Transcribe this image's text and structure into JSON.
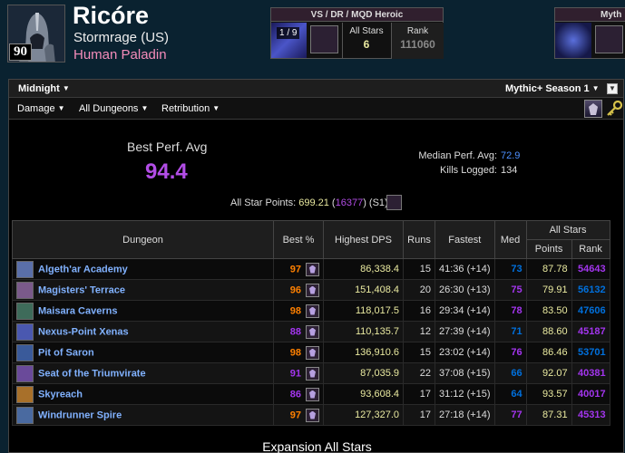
{
  "header": {
    "name": "Ricóre",
    "realm": "Stormrage (US)",
    "class_text": "Human Paladin",
    "level": "90"
  },
  "raid": {
    "title": "VS / DR / MQD Heroic",
    "progress": "1 / 9",
    "allstars_label": "All Stars",
    "allstars_value": "6",
    "rank_label": "Rank",
    "rank_value": "111060"
  },
  "mythic_box": {
    "title": "Myth"
  },
  "toolbar": {
    "season_left": "Midnight",
    "season_right": "Mythic+ Season 1",
    "metric": "Damage",
    "zone": "All Dungeons",
    "spec": "Retribution"
  },
  "summary": {
    "best_avg_label": "Best Perf. Avg",
    "best_avg_value": "94.4",
    "median_label": "Median Perf. Avg:",
    "median_value": "72.9",
    "kills_label": "Kills Logged:",
    "kills_value": "134",
    "allstar_label": "All Star Points:",
    "allstar_points": "699.21",
    "allstar_rank": "16377",
    "allstar_suffix": "(S1)"
  },
  "table": {
    "headers": {
      "dungeon": "Dungeon",
      "best": "Best %",
      "dps": "Highest DPS",
      "runs": "Runs",
      "fastest": "Fastest",
      "med": "Med",
      "allstars": "All Stars",
      "points": "Points",
      "rank": "Rank"
    },
    "rows": [
      {
        "name": "Algeth'ar Academy",
        "best": "97",
        "dps": "86,338.4",
        "runs": "15",
        "fastest": "41:36 (+14)",
        "med": "73",
        "points": "87.78",
        "rank": "54643",
        "best_color": "orange",
        "med_color": "blue",
        "rank_color": "purple",
        "icon_color": "#5a6fa8"
      },
      {
        "name": "Magisters' Terrace",
        "best": "96",
        "dps": "151,408.4",
        "runs": "20",
        "fastest": "26:30 (+13)",
        "med": "75",
        "points": "79.91",
        "rank": "56132",
        "best_color": "orange",
        "med_color": "purple",
        "rank_color": "blue",
        "icon_color": "#7a5a8a"
      },
      {
        "name": "Maisara Caverns",
        "best": "98",
        "dps": "118,017.5",
        "runs": "16",
        "fastest": "29:34 (+14)",
        "med": "78",
        "points": "83.50",
        "rank": "47606",
        "best_color": "orange",
        "med_color": "purple",
        "rank_color": "blue",
        "icon_color": "#3e6b5a"
      },
      {
        "name": "Nexus-Point Xenas",
        "best": "88",
        "dps": "110,135.7",
        "runs": "12",
        "fastest": "27:39 (+14)",
        "med": "71",
        "points": "88.60",
        "rank": "45187",
        "best_color": "purple",
        "med_color": "blue",
        "rank_color": "purple",
        "icon_color": "#4a58b0"
      },
      {
        "name": "Pit of Saron",
        "best": "98",
        "dps": "136,910.6",
        "runs": "15",
        "fastest": "23:02 (+14)",
        "med": "76",
        "points": "86.46",
        "rank": "53701",
        "best_color": "orange",
        "med_color": "purple",
        "rank_color": "blue",
        "icon_color": "#3a5a9a"
      },
      {
        "name": "Seat of the Triumvirate",
        "best": "91",
        "dps": "87,035.9",
        "runs": "22",
        "fastest": "37:08 (+15)",
        "med": "66",
        "points": "92.07",
        "rank": "40381",
        "best_color": "purple",
        "med_color": "blue",
        "rank_color": "purple",
        "icon_color": "#6a4a9a"
      },
      {
        "name": "Skyreach",
        "best": "86",
        "dps": "93,608.4",
        "runs": "17",
        "fastest": "31:12 (+15)",
        "med": "64",
        "points": "93.57",
        "rank": "40017",
        "best_color": "purple",
        "med_color": "blue",
        "rank_color": "purple",
        "icon_color": "#a8702a"
      },
      {
        "name": "Windrunner Spire",
        "best": "97",
        "dps": "127,327.0",
        "runs": "17",
        "fastest": "27:18 (+14)",
        "med": "77",
        "points": "87.31",
        "rank": "45313",
        "best_color": "orange",
        "med_color": "purple",
        "rank_color": "purple",
        "icon_color": "#4a6aa0"
      }
    ]
  },
  "footer": {
    "expansion_title": "Expansion All Stars"
  },
  "colors": {
    "orange": "#ff8000",
    "purple": "#a335ee",
    "blue": "#0070dd",
    "class_color": "#f48cba",
    "points_color": "#eaeaa0"
  }
}
